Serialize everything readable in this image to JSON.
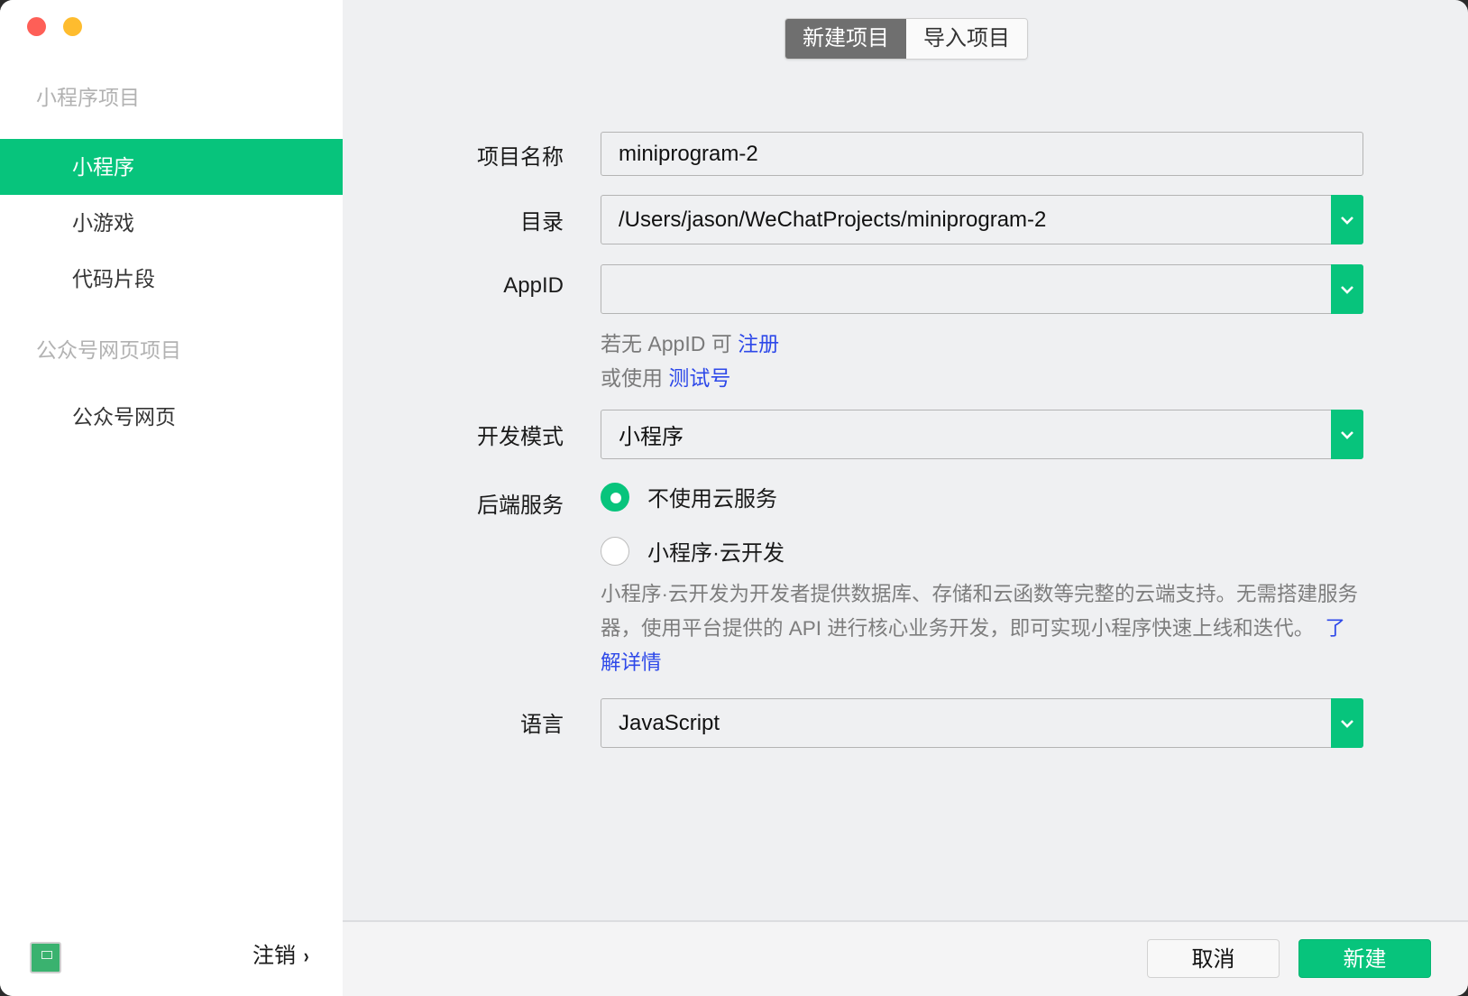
{
  "window": {
    "traffic_lights": [
      "close",
      "minimize"
    ]
  },
  "sidebar": {
    "groups": [
      {
        "title": "小程序项目",
        "items": [
          {
            "label": "小程序",
            "active": true
          },
          {
            "label": "小游戏",
            "active": false
          },
          {
            "label": "代码片段",
            "active": false
          }
        ]
      },
      {
        "title": "公众号网页项目",
        "items": [
          {
            "label": "公众号网页",
            "active": false
          }
        ]
      }
    ],
    "logout_label": "注销",
    "logout_icon": "chevron-right-icon",
    "avatar_icon": "user-avatar-icon"
  },
  "tabs": [
    {
      "label": "新建项目",
      "active": true
    },
    {
      "label": "导入项目",
      "active": false
    }
  ],
  "form": {
    "project_name": {
      "label": "项目名称",
      "value": "miniprogram-2"
    },
    "directory": {
      "label": "目录",
      "value": "/Users/jason/WeChatProjects/miniprogram-2"
    },
    "appid": {
      "label": "AppID",
      "value": "",
      "hint1_prefix": "若无 AppID 可",
      "hint1_link": "注册",
      "hint2_prefix": "或使用",
      "hint2_link": "测试号"
    },
    "dev_mode": {
      "label": "开发模式",
      "value": "小程序"
    },
    "backend": {
      "label": "后端服务",
      "options": [
        {
          "label": "不使用云服务",
          "selected": true
        },
        {
          "label": "小程序·云开发",
          "selected": false
        }
      ],
      "description": "小程序·云开发为开发者提供数据库、存储和云函数等完整的云端支持。无需搭建服务器，使用平台提供的 API 进行核心业务开发，即可实现小程序快速上线和迭代。",
      "learn_more": "了解详情"
    },
    "language": {
      "label": "语言",
      "value": "JavaScript"
    }
  },
  "footer": {
    "cancel_label": "取消",
    "create_label": "新建"
  },
  "colors": {
    "accent": "#07c47c",
    "link": "#2e49e9",
    "tab_active": "#6f6f6f"
  }
}
